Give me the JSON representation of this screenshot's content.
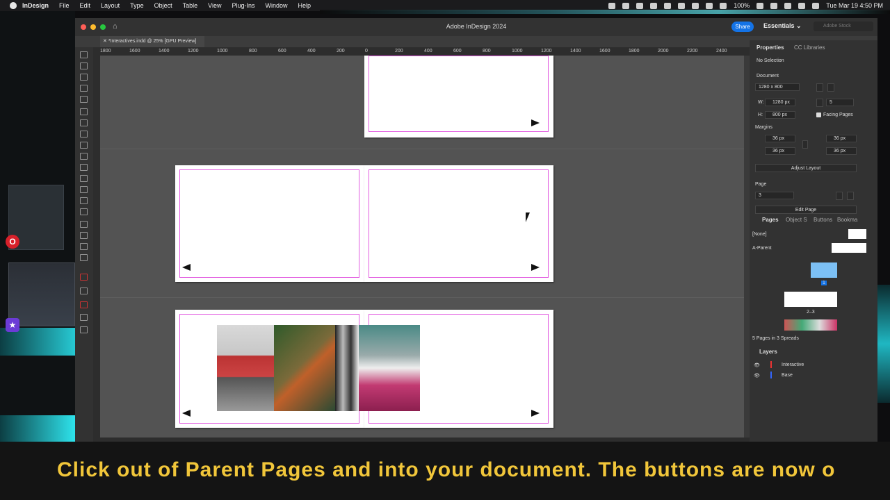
{
  "menubar": {
    "app": "InDesign",
    "items": [
      "File",
      "Edit",
      "Layout",
      "Type",
      "Object",
      "Table",
      "View",
      "Plug-Ins",
      "Window",
      "Help"
    ],
    "battery": "100%",
    "datetime": "Tue Mar 19  4:50 PM"
  },
  "window": {
    "title": "Adobe InDesign 2024",
    "share": "Share",
    "workspace": "Essentials",
    "stock_placeholder": "Adobe Stock",
    "doc_tab": "*Interactives.indd @ 25% [GPU Preview]"
  },
  "ruler": {
    "labels": [
      "1800",
      "1600",
      "1400",
      "1200",
      "1000",
      "800",
      "600",
      "400",
      "200",
      "0",
      "200",
      "400",
      "600",
      "800",
      "1000",
      "1200",
      "1400",
      "1600",
      "1800",
      "2000",
      "2200",
      "2400"
    ]
  },
  "panel": {
    "tabs": [
      "Properties",
      "CC Libraries"
    ],
    "no_selection": "No Selection",
    "document_label": "Document",
    "size_preset": "1280 x 800",
    "w_label": "W:",
    "width": "1280 px",
    "h_label": "H:",
    "height": "800 px",
    "pages_count": "5",
    "facing_pages": "Facing Pages",
    "margins_label": "Margins",
    "margin_top": "36 px",
    "margin_bottom": "36 px",
    "margin_inside": "36 px",
    "margin_outside": "36 px",
    "adjust_layout": "Adjust Layout",
    "page_label": "Page",
    "page_value": "3",
    "edit_page": "Edit Page"
  },
  "pages_panel": {
    "tabs": [
      "Pages",
      "Object S",
      "Buttons",
      "Bookma"
    ],
    "none": "[None]",
    "parent": "A-Parent",
    "page1_num": "1",
    "spread2_label": "2–3",
    "summary": "5 Pages in 3 Spreads"
  },
  "layers_panel": {
    "title": "Layers",
    "layers": [
      "Interactive",
      "Base"
    ]
  },
  "caption": "Click out of Parent Pages and into your document. The buttons are now o"
}
